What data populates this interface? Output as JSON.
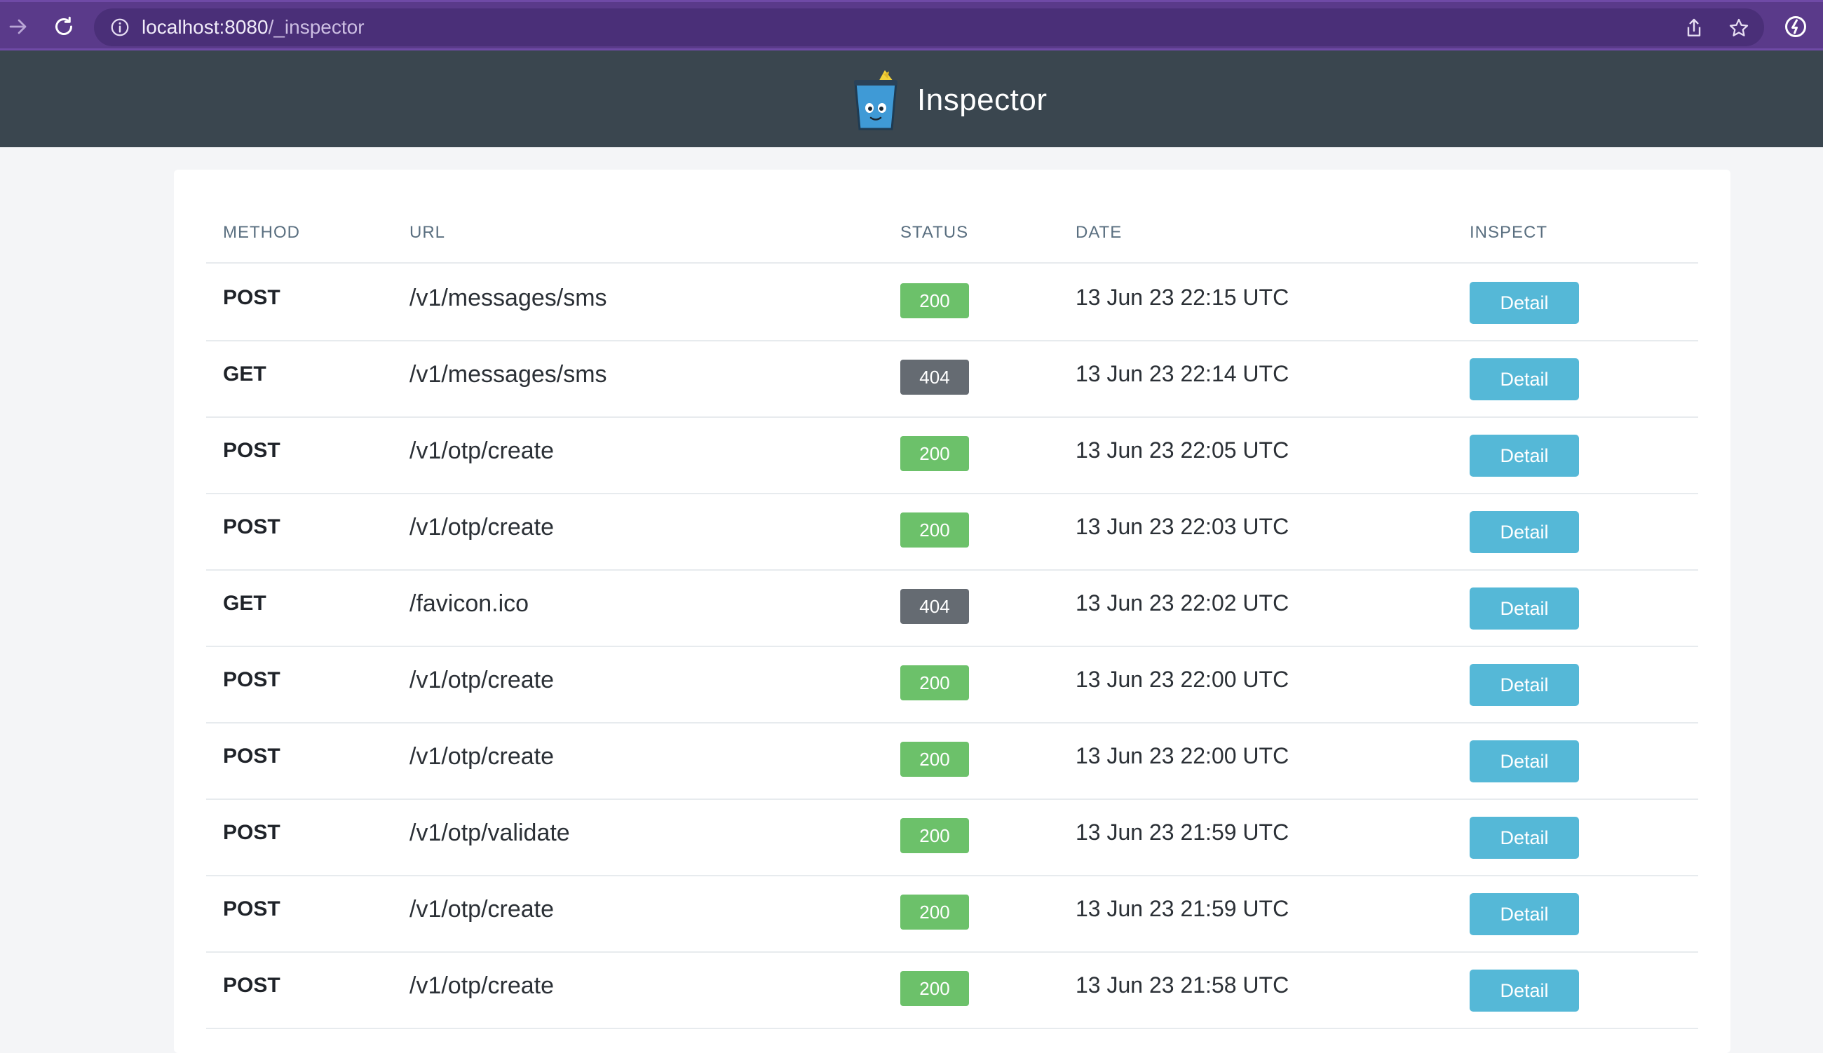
{
  "browser": {
    "url_host": "localhost:8080",
    "url_path": "/_inspector",
    "accent": "#5a3a8a"
  },
  "header": {
    "title": "Inspector",
    "background": "#3a464f"
  },
  "table": {
    "columns": [
      "METHOD",
      "URL",
      "STATUS",
      "DATE",
      "INSPECT"
    ],
    "rows": [
      {
        "method": "POST",
        "url": "/v1/messages/sms",
        "status": "200",
        "date": "13 Jun 23 22:15 UTC",
        "action": "Detail"
      },
      {
        "method": "GET",
        "url": "/v1/messages/sms",
        "status": "404",
        "date": "13 Jun 23 22:14 UTC",
        "action": "Detail"
      },
      {
        "method": "POST",
        "url": "/v1/otp/create",
        "status": "200",
        "date": "13 Jun 23 22:05 UTC",
        "action": "Detail"
      },
      {
        "method": "POST",
        "url": "/v1/otp/create",
        "status": "200",
        "date": "13 Jun 23 22:03 UTC",
        "action": "Detail"
      },
      {
        "method": "GET",
        "url": "/favicon.ico",
        "status": "404",
        "date": "13 Jun 23 22:02 UTC",
        "action": "Detail"
      },
      {
        "method": "POST",
        "url": "/v1/otp/create",
        "status": "200",
        "date": "13 Jun 23 22:00 UTC",
        "action": "Detail"
      },
      {
        "method": "POST",
        "url": "/v1/otp/create",
        "status": "200",
        "date": "13 Jun 23 22:00 UTC",
        "action": "Detail"
      },
      {
        "method": "POST",
        "url": "/v1/otp/validate",
        "status": "200",
        "date": "13 Jun 23 21:59 UTC",
        "action": "Detail"
      },
      {
        "method": "POST",
        "url": "/v1/otp/create",
        "status": "200",
        "date": "13 Jun 23 21:59 UTC",
        "action": "Detail"
      },
      {
        "method": "POST",
        "url": "/v1/otp/create",
        "status": "200",
        "date": "13 Jun 23 21:58 UTC",
        "action": "Detail"
      }
    ]
  },
  "colors": {
    "status_ok": "#6cc16a",
    "status_not_found": "#656b72",
    "detail_button": "#55b8d7"
  },
  "icons": [
    "forward-arrow-icon",
    "reload-icon",
    "info-icon",
    "share-icon",
    "star-icon",
    "extension-icon",
    "bucket-logo-icon"
  ]
}
